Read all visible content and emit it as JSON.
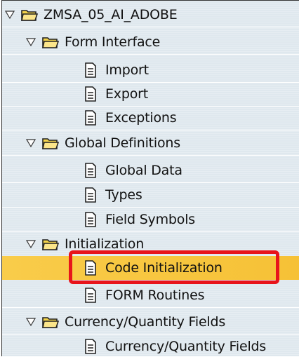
{
  "tree": {
    "root": {
      "label": "ZMSA_05_AI_ADOBE",
      "expanded": true
    },
    "form_interface": {
      "label": "Form Interface",
      "items": [
        "Import",
        "Export",
        "Exceptions"
      ]
    },
    "global_definitions": {
      "label": "Global Definitions",
      "items": [
        "Global Data",
        "Types",
        "Field Symbols"
      ]
    },
    "initialization": {
      "label": "Initialization",
      "items": [
        "Code Initialization",
        "FORM Routines"
      ],
      "selected": "Code Initialization"
    },
    "currency_quantity": {
      "label": "Currency/Quantity Fields",
      "items": [
        "Currency/Quantity Fields"
      ]
    }
  },
  "icons": {
    "expand": "triangle-down-icon",
    "folder": "folder-open-icon",
    "document": "document-icon"
  },
  "colors": {
    "selection": "#f8c840",
    "highlight_border": "#e8141b",
    "tree_background": "#dfe8ee"
  }
}
